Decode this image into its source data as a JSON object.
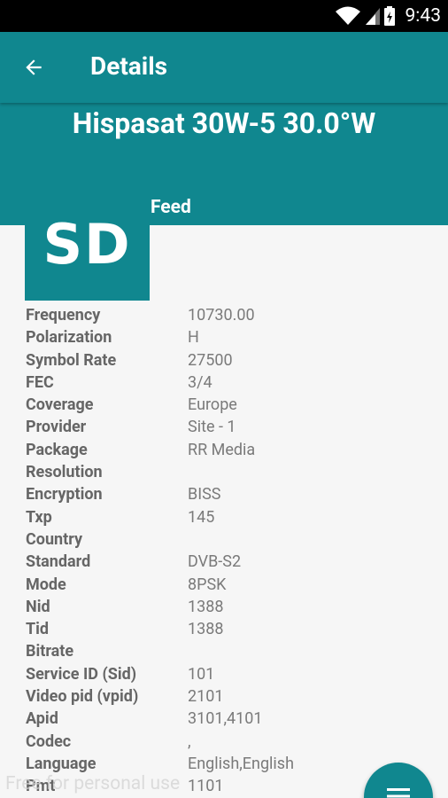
{
  "status_bar": {
    "time": "9:43",
    "icons": [
      "wifi-icon",
      "signal-icon",
      "battery-icon"
    ]
  },
  "appbar": {
    "back_icon": "arrow-back-icon",
    "title": "Details"
  },
  "header": {
    "satellite": "Hispasat 30W-5 30.0°W",
    "channel_name": "Feed",
    "logo_text": "SD"
  },
  "details": [
    {
      "label": "Frequency",
      "value": "10730.00"
    },
    {
      "label": "Polarization",
      "value": "H"
    },
    {
      "label": "Symbol Rate",
      "value": "27500"
    },
    {
      "label": "FEC",
      "value": "3/4"
    },
    {
      "label": "Coverage",
      "value": "Europe"
    },
    {
      "label": "Provider",
      "value": "Site - 1"
    },
    {
      "label": "Package",
      "value": "RR Media"
    },
    {
      "label": "Resolution",
      "value": ""
    },
    {
      "label": "Encryption",
      "value": "BISS"
    },
    {
      "label": "Txp",
      "value": "145"
    },
    {
      "label": "Country",
      "value": ""
    },
    {
      "label": "Standard",
      "value": "DVB-S2"
    },
    {
      "label": "Mode",
      "value": "8PSK"
    },
    {
      "label": "Nid",
      "value": "1388"
    },
    {
      "label": "Tid",
      "value": "1388"
    },
    {
      "label": "Bitrate",
      "value": ""
    },
    {
      "label": "Service ID (Sid)",
      "value": "101"
    },
    {
      "label": "Video pid (vpid)",
      "value": "2101"
    },
    {
      "label": "Apid",
      "value": "3101,4101"
    },
    {
      "label": "Codec",
      "value": ","
    },
    {
      "label": "Language",
      "value": "English,English"
    },
    {
      "label": "Pmt",
      "value": "1101"
    }
  ],
  "watermark": "Free for personal use",
  "fab": {
    "icon": "menu-icon"
  },
  "colors": {
    "primary": "#10878f",
    "status_bar": "#000000",
    "background": "#f6f6f6",
    "label_text": "#666666",
    "value_text": "#7a7a7a"
  }
}
